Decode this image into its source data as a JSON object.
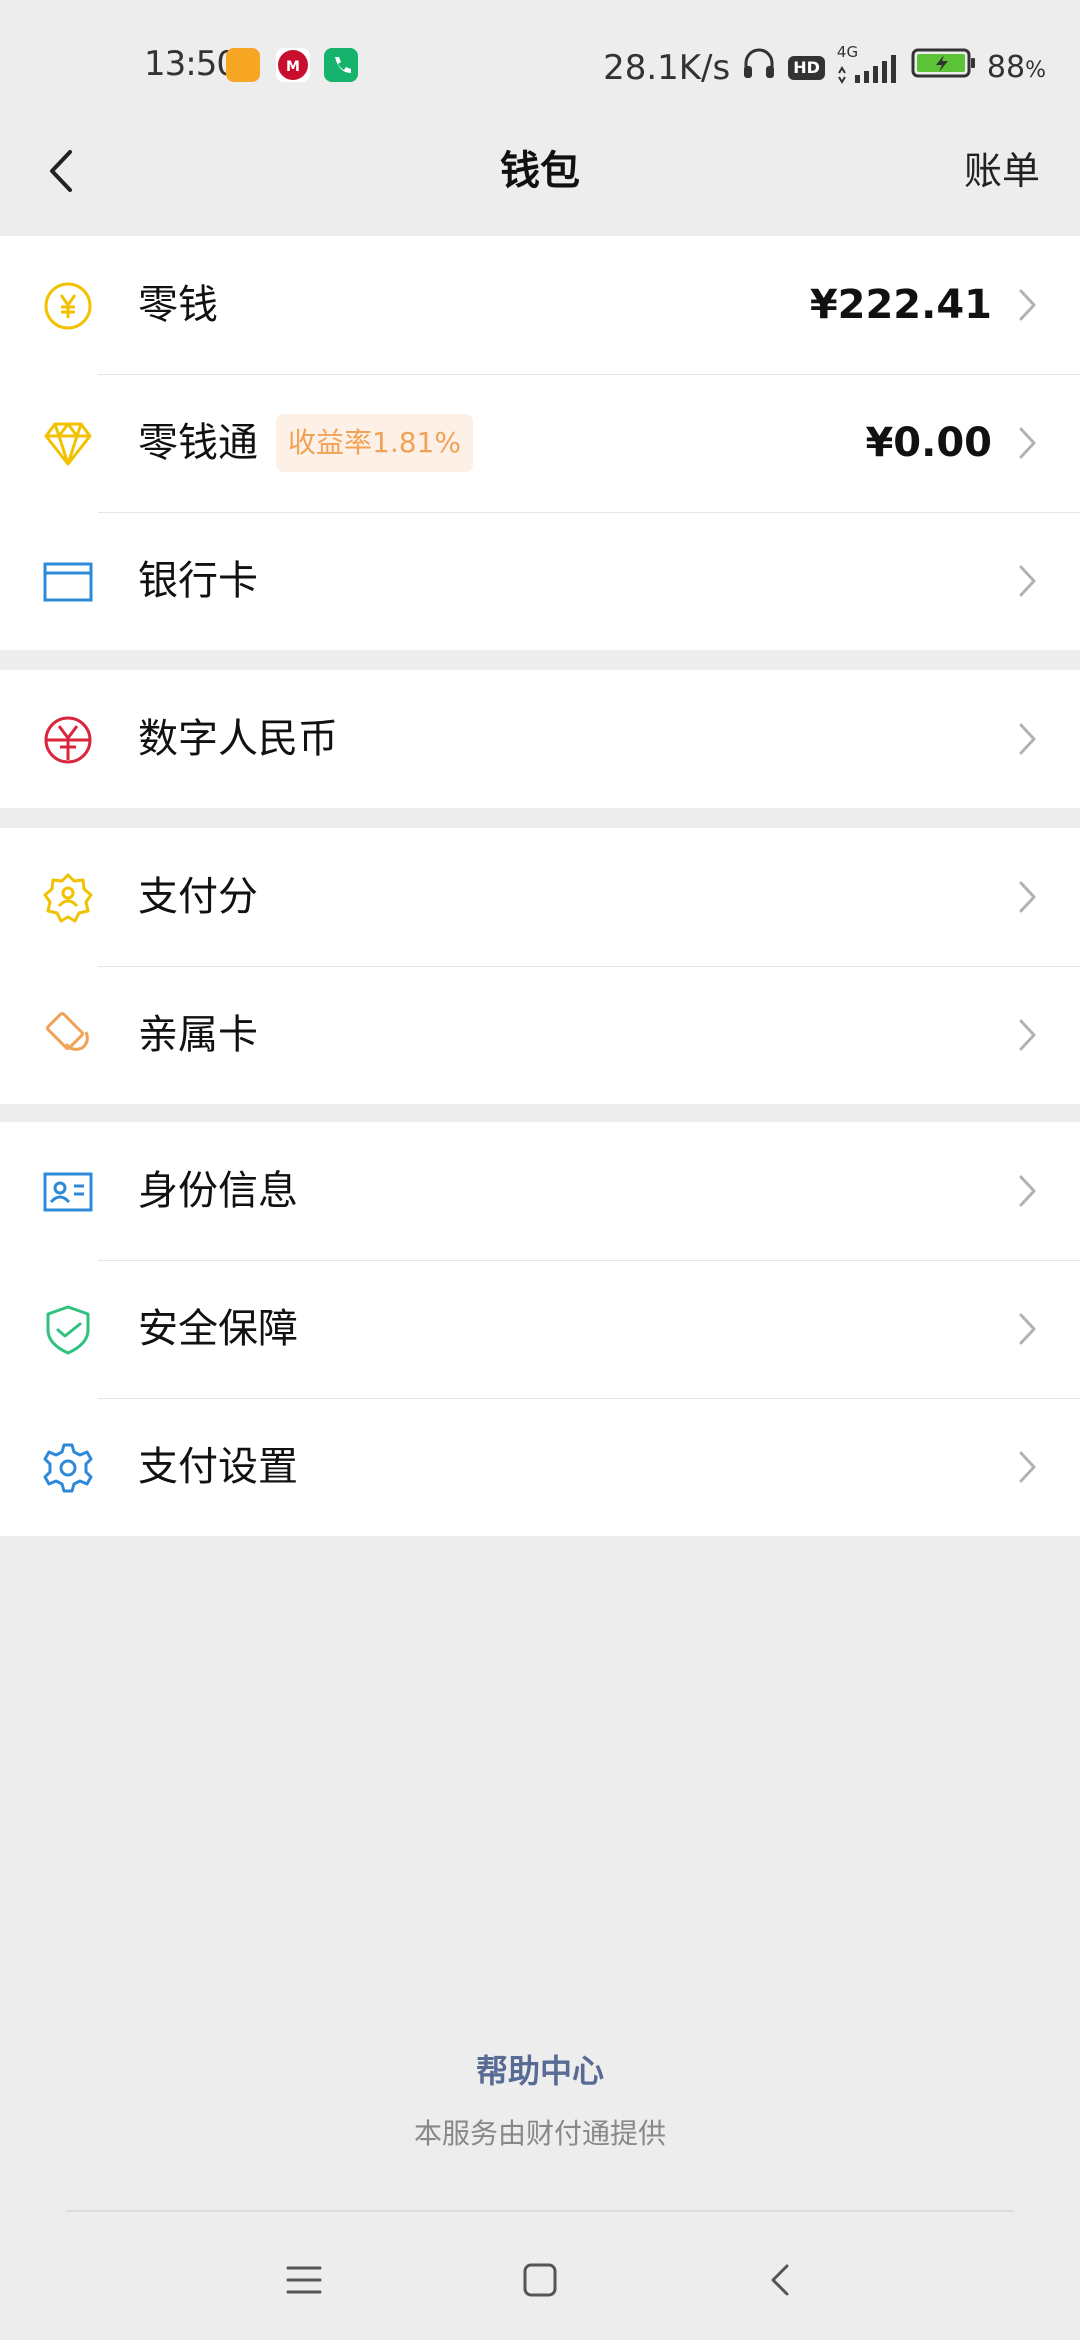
{
  "status": {
    "time": "13:50",
    "net_speed": "28.1K/s",
    "hd": "HD",
    "network": "4G",
    "battery": "88",
    "battery_unit": "%"
  },
  "nav": {
    "title": "钱包",
    "right_label": "账单"
  },
  "groups": [
    {
      "items": [
        {
          "label": "零钱",
          "value": "¥222.41",
          "icon": "yuan-coin-icon"
        },
        {
          "label": "零钱通",
          "badge": "收益率1.81%",
          "value": "¥0.00",
          "icon": "diamond-icon"
        },
        {
          "label": "银行卡",
          "icon": "bank-card-icon"
        }
      ]
    },
    {
      "items": [
        {
          "label": "数字人民币",
          "icon": "digital-rmb-icon"
        }
      ]
    },
    {
      "items": [
        {
          "label": "支付分",
          "icon": "pay-score-badge-icon"
        },
        {
          "label": "亲属卡",
          "icon": "family-card-icon"
        }
      ]
    },
    {
      "items": [
        {
          "label": "身份信息",
          "icon": "id-card-icon"
        },
        {
          "label": "安全保障",
          "icon": "shield-check-icon"
        },
        {
          "label": "支付设置",
          "icon": "gear-icon"
        }
      ]
    }
  ],
  "footer": {
    "help": "帮助中心",
    "provider": "本服务由财付通提供"
  },
  "colors": {
    "background": "#ededed",
    "yellow": "#f2c200",
    "blue": "#2c8ad8",
    "red": "#d9263a",
    "orange": "#f0a356",
    "green": "#2ec27e",
    "link": "#576b95"
  }
}
